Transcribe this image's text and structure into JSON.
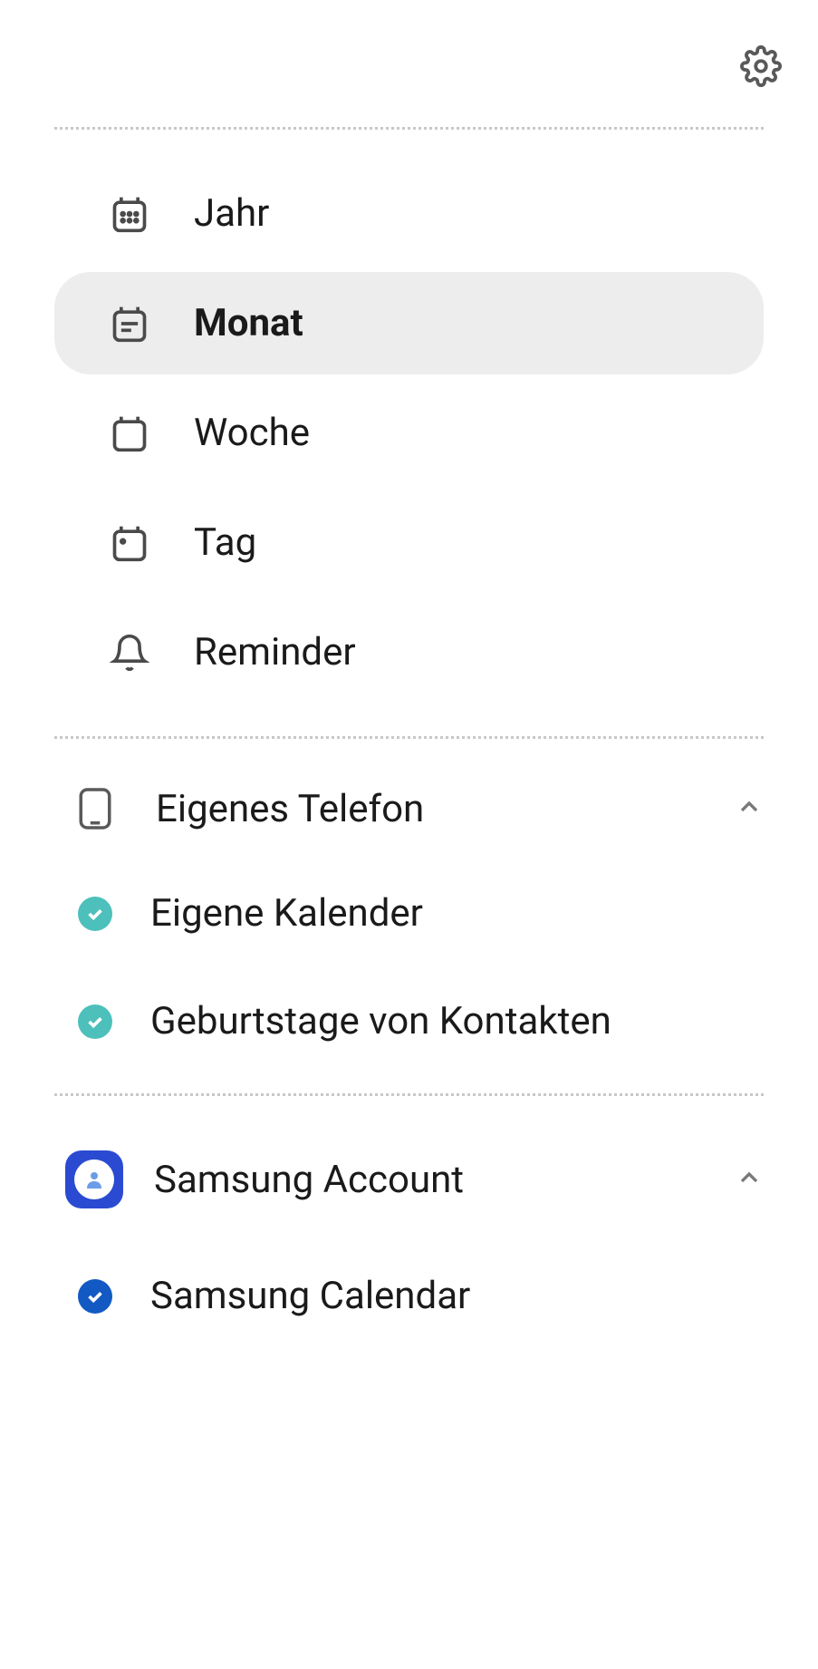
{
  "views": {
    "year": "Jahr",
    "month": "Monat",
    "week": "Woche",
    "day": "Tag",
    "reminder": "Reminder"
  },
  "selected_view": "month",
  "accounts": {
    "phone": {
      "label": "Eigenes Telefon",
      "calendars": [
        {
          "label": "Eigene Kalender",
          "checked": true,
          "color": "teal"
        },
        {
          "label": "Geburtstage von Kontakten",
          "checked": true,
          "color": "teal"
        }
      ]
    },
    "samsung": {
      "label": "Samsung Account",
      "calendars": [
        {
          "label": "Samsung Calendar",
          "checked": true,
          "color": "blue"
        }
      ]
    }
  }
}
